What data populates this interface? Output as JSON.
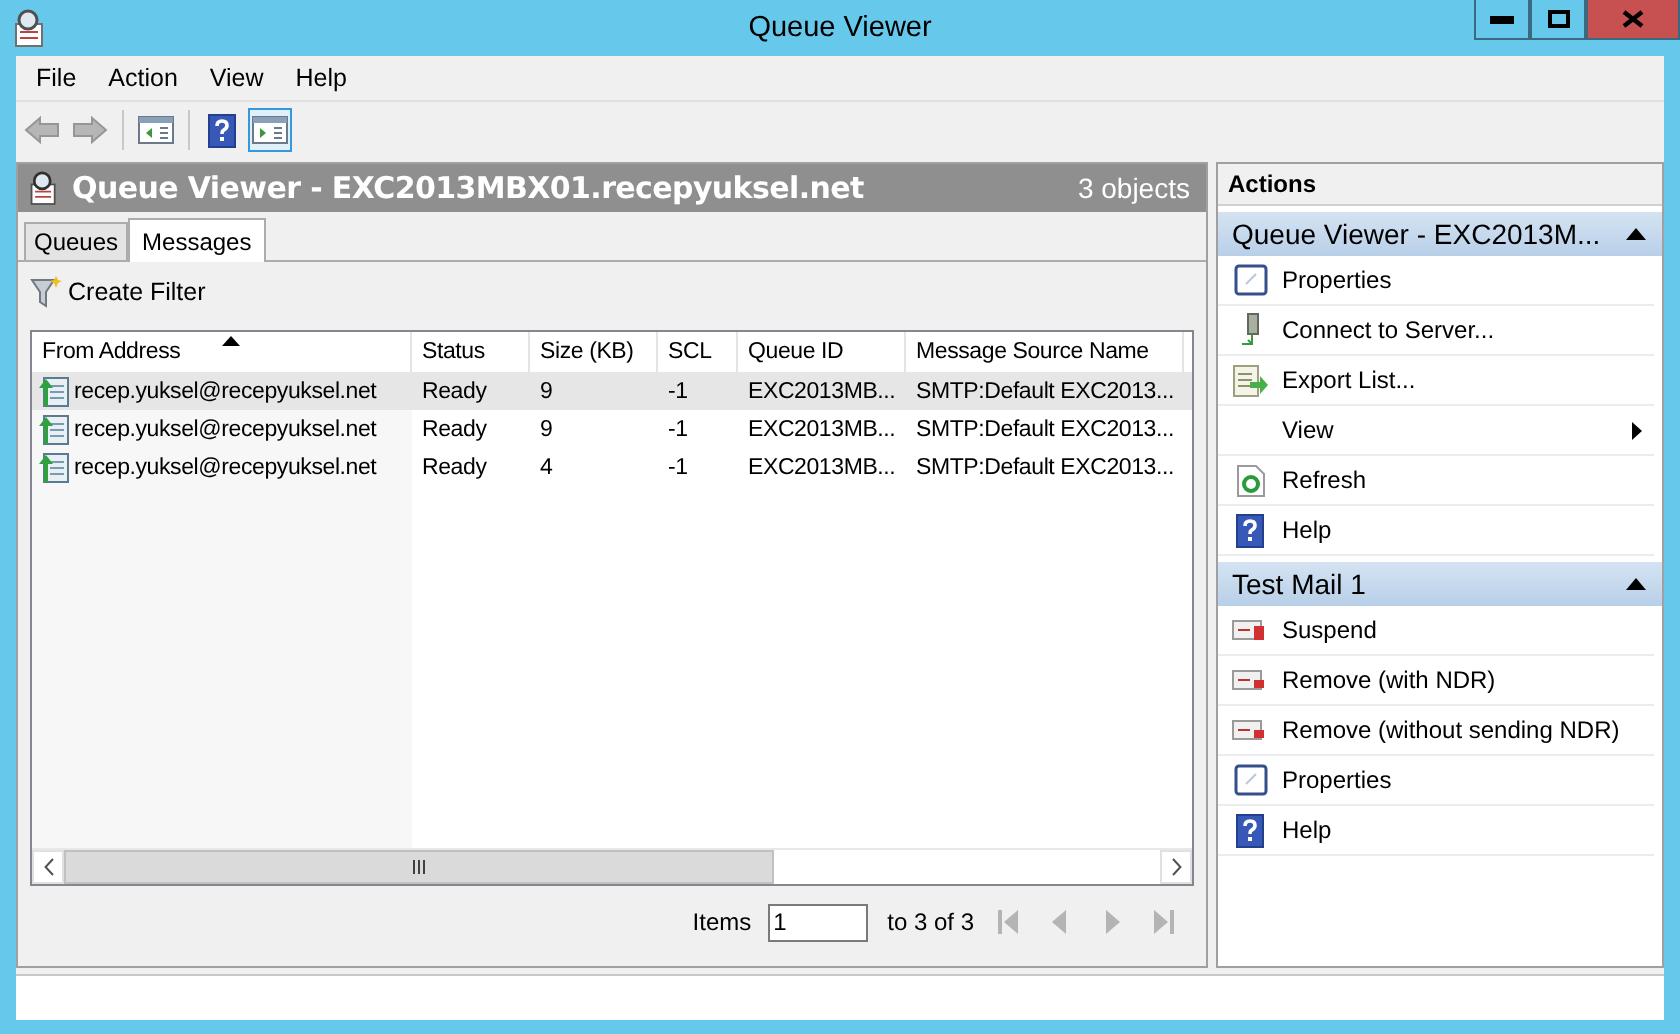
{
  "window": {
    "title": "Queue Viewer"
  },
  "menu": [
    "File",
    "Action",
    "View",
    "Help"
  ],
  "toolbar": [
    {
      "kind": "back",
      "disabled": true,
      "pressed": false
    },
    {
      "kind": "forward",
      "disabled": true,
      "pressed": false
    },
    {
      "kind": "console-tree",
      "disabled": false,
      "pressed": false
    },
    {
      "kind": "help",
      "disabled": false,
      "pressed": false
    },
    {
      "kind": "action-pane",
      "disabled": false,
      "pressed": true
    }
  ],
  "content": {
    "title": "Queue Viewer - EXC2013MBX01.recepyuksel.net",
    "count": "3 objects",
    "tabs": [
      {
        "label": "Queues",
        "selected": false
      },
      {
        "label": "Messages",
        "selected": true
      }
    ],
    "filter_button": "Create Filter",
    "table": {
      "columns": [
        {
          "label": "From Address",
          "sorted": true
        },
        {
          "label": "Status",
          "sorted": false
        },
        {
          "label": "Size (KB)",
          "sorted": false
        },
        {
          "label": "SCL",
          "sorted": false
        },
        {
          "label": "Queue ID",
          "sorted": false
        },
        {
          "label": "Message Source Name",
          "sorted": false
        }
      ],
      "rows": [
        {
          "selected": true,
          "cells": [
            "recep.yuksel@recepyuksel.net",
            "Ready",
            "9",
            "-1",
            "EXC2013MB...",
            "SMTP:Default EXC2013..."
          ]
        },
        {
          "selected": false,
          "cells": [
            "recep.yuksel@recepyuksel.net",
            "Ready",
            "9",
            "-1",
            "EXC2013MB...",
            "SMTP:Default EXC2013..."
          ]
        },
        {
          "selected": false,
          "cells": [
            "recep.yuksel@recepyuksel.net",
            "Ready",
            "4",
            "-1",
            "EXC2013MB...",
            "SMTP:Default EXC2013..."
          ]
        }
      ]
    },
    "pager": {
      "label": "Items",
      "value": "1",
      "range": "to 3 of 3",
      "buttons": [
        {
          "kind": "first",
          "disabled": true
        },
        {
          "kind": "previous",
          "disabled": true
        },
        {
          "kind": "next",
          "disabled": true
        },
        {
          "kind": "last",
          "disabled": true
        }
      ]
    }
  },
  "actions": {
    "title": "Actions",
    "groups": [
      {
        "title": "Queue Viewer - EXC2013M...",
        "expanded": true,
        "items": [
          {
            "label": "Properties",
            "kind": "properties",
            "submenu": false
          },
          {
            "label": "Connect to Server...",
            "kind": "connect",
            "submenu": false
          },
          {
            "label": "Export List...",
            "kind": "export",
            "submenu": false
          },
          {
            "label": "View",
            "kind": "none",
            "submenu": true
          },
          {
            "label": "Refresh",
            "kind": "refresh",
            "submenu": false
          },
          {
            "label": "Help",
            "kind": "help",
            "submenu": false
          }
        ]
      },
      {
        "title": "Test Mail 1",
        "expanded": true,
        "items": [
          {
            "label": "Suspend",
            "kind": "suspend",
            "submenu": false
          },
          {
            "label": "Remove (with NDR)",
            "kind": "remove",
            "submenu": false
          },
          {
            "label": "Remove (without sending NDR)",
            "kind": "remove",
            "submenu": false
          },
          {
            "label": "Properties",
            "kind": "properties",
            "submenu": false
          },
          {
            "label": "Help",
            "kind": "help",
            "submenu": false
          }
        ]
      }
    ]
  }
}
